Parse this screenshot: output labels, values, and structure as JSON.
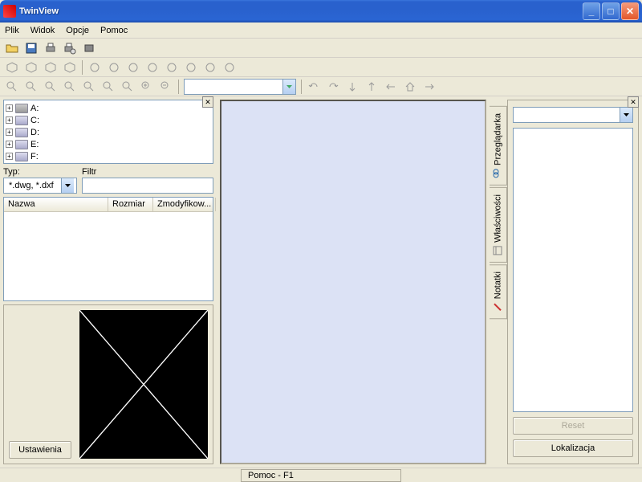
{
  "window": {
    "title": "TwinView"
  },
  "menu": {
    "items": [
      "Plik",
      "Widok",
      "Opcje",
      "Pomoc"
    ]
  },
  "drives": {
    "items": [
      {
        "letter": "A:",
        "type": "floppy"
      },
      {
        "letter": "C:",
        "type": "hdd"
      },
      {
        "letter": "D:",
        "type": "hdd"
      },
      {
        "letter": "E:",
        "type": "hdd"
      },
      {
        "letter": "F:",
        "type": "hdd"
      }
    ]
  },
  "filter": {
    "typ_label": "Typ:",
    "typ_value": "*.dwg, *.dxf",
    "filtr_label": "Filtr",
    "filtr_value": ""
  },
  "filelist": {
    "cols": [
      "Nazwa",
      "Rozmiar",
      "Zmodyfikow..."
    ]
  },
  "preview": {
    "settings_btn": "Ustawienia"
  },
  "right": {
    "tabs": [
      "Przeglądarka",
      "Właściwości",
      "Notatki"
    ],
    "reset_btn": "Reset",
    "lokalizacja_btn": "Lokalizacja"
  },
  "status": {
    "help": "Pomoc - F1"
  }
}
